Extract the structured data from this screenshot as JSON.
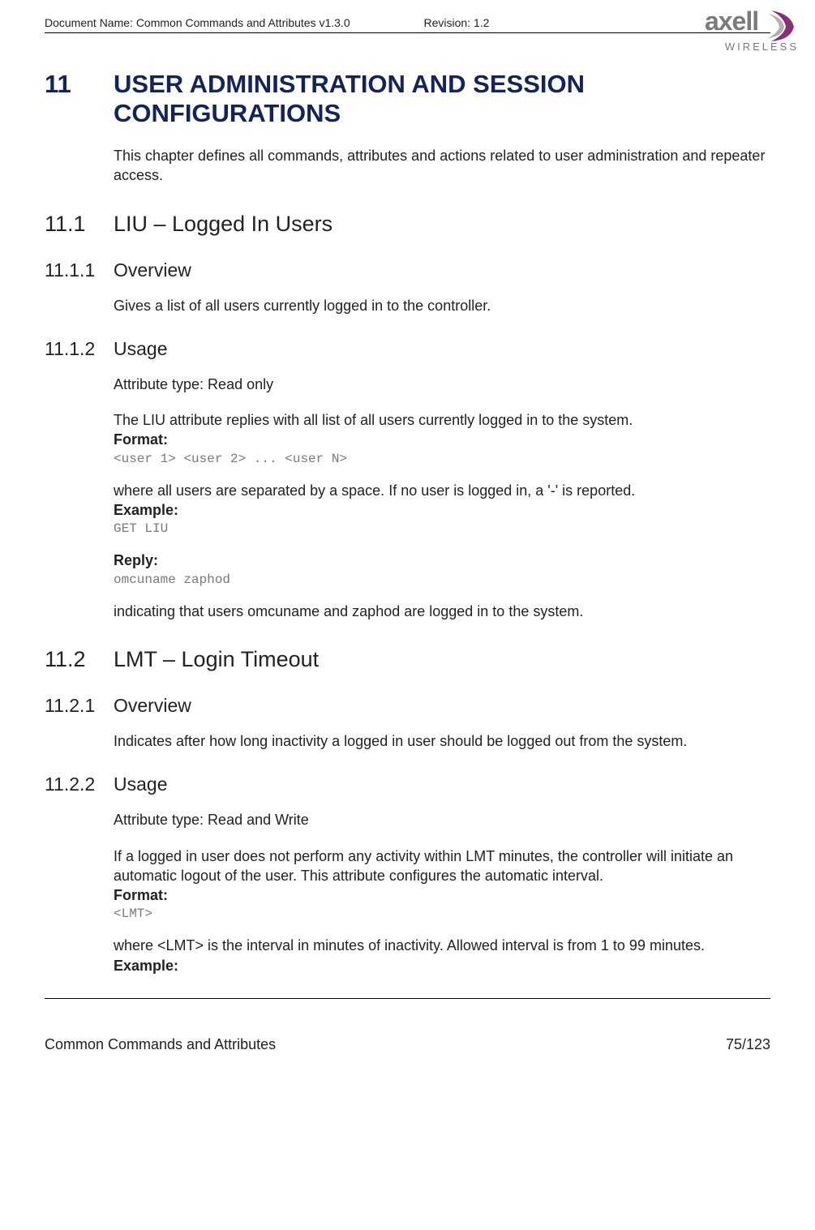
{
  "header": {
    "doc_name": "Document Name: Common Commands and Attributes v1.3.0",
    "revision": "Revision: 1.2",
    "logo_main": "axell",
    "logo_sub": "WIRELESS"
  },
  "chapter": {
    "num": "11",
    "title": "USER ADMINISTRATION AND SESSION CONFIGURATIONS",
    "intro": "This chapter defines all commands, attributes and actions related to user administration and repeater access."
  },
  "s11_1": {
    "num": "11.1",
    "title": "LIU – Logged In Users"
  },
  "s11_1_1": {
    "num": "11.1.1",
    "title": "Overview",
    "text": "Gives a list of all users currently logged in to the controller."
  },
  "s11_1_2": {
    "num": "11.1.2",
    "title": "Usage",
    "attr_type": "Attribute type: Read only",
    "desc": "The LIU attribute replies with all list of all users currently logged in to the system.",
    "format_label": "Format:",
    "format_code": "<user 1> <user 2> ... <user N>",
    "where": "where all users are separated by a space. If no user is logged in, a '-' is reported.",
    "example_label": "Example:",
    "example_code": "GET LIU",
    "reply_label": "Reply:",
    "reply_code": "omcuname zaphod",
    "indicating": "indicating that users omcuname and zaphod are logged in to the system."
  },
  "s11_2": {
    "num": "11.2",
    "title": "LMT – Login Timeout"
  },
  "s11_2_1": {
    "num": "11.2.1",
    "title": "Overview",
    "text": "Indicates after how long inactivity a logged in user should be logged out from the system."
  },
  "s11_2_2": {
    "num": "11.2.2",
    "title": "Usage",
    "attr_type": "Attribute type: Read and Write",
    "desc": "If a logged in user does not perform any activity within LMT minutes, the controller will initiate an automatic logout of the user. This attribute configures the automatic interval.",
    "format_label": "Format:",
    "format_code": "<LMT>",
    "where": "where <LMT> is the interval in minutes of inactivity. Allowed interval is from 1 to 99 minutes.",
    "example_label": "Example:"
  },
  "footer": {
    "left": "Common Commands and Attributes",
    "right": "75/123"
  }
}
